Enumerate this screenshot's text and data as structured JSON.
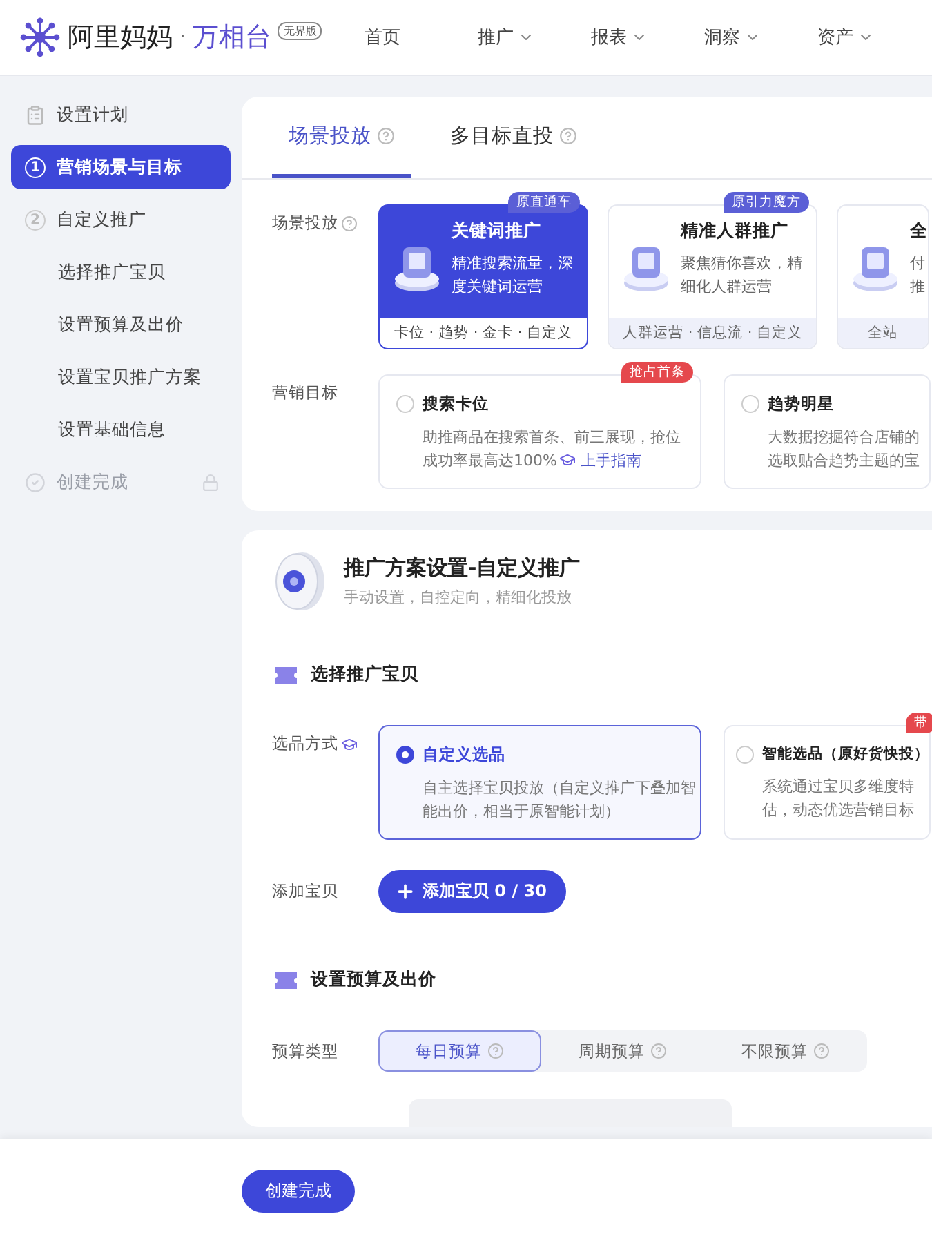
{
  "header": {
    "logo": {
      "brand": "阿里妈妈",
      "separator": "·",
      "product": "万相台",
      "edition": "无界版"
    },
    "nav": [
      {
        "label": "首页",
        "dropdown": false
      },
      {
        "label": "推广",
        "dropdown": true
      },
      {
        "label": "报表",
        "dropdown": true
      },
      {
        "label": "洞察",
        "dropdown": true
      },
      {
        "label": "资产",
        "dropdown": true
      }
    ]
  },
  "sidebar": {
    "items": [
      {
        "kind": "header",
        "label": "设置计划",
        "selected": false,
        "disabled": false
      },
      {
        "kind": "step",
        "number": "1",
        "label": "营销场景与目标",
        "selected": true,
        "disabled": false
      },
      {
        "kind": "step",
        "number": "2",
        "label": "自定义推广",
        "selected": false,
        "disabled": false
      },
      {
        "kind": "sub",
        "label": "选择推广宝贝",
        "selected": false,
        "disabled": false
      },
      {
        "kind": "sub",
        "label": "设置预算及出价",
        "selected": false,
        "disabled": false
      },
      {
        "kind": "sub",
        "label": "设置宝贝推广方案",
        "selected": false,
        "disabled": false
      },
      {
        "kind": "sub",
        "label": "设置基础信息",
        "selected": false,
        "disabled": false
      },
      {
        "kind": "final",
        "label": "创建完成",
        "selected": false,
        "disabled": true
      }
    ]
  },
  "scene_panel": {
    "tabs": [
      {
        "label": "场景投放",
        "selected": true
      },
      {
        "label": "多目标直投",
        "selected": false
      }
    ],
    "scene_label": "场景投放",
    "scenes": [
      {
        "badge": "原直通车",
        "title": "关键词推广",
        "desc": [
          "精准搜索流量，深",
          "度关键词运营"
        ],
        "footer": "卡位 · 趋势 · 金卡 · 自定义",
        "selected": true
      },
      {
        "badge": "原引力魔方",
        "title": "精准人群推广",
        "desc": [
          "聚焦猜你喜欢，精",
          "细化人群运营"
        ],
        "footer": "人群运营 · 信息流 · 自定义",
        "selected": false
      },
      {
        "title": "全",
        "desc": [
          "付",
          "推"
        ],
        "footer": "全站",
        "selected": false
      }
    ],
    "goal_label": "营销目标",
    "goals": [
      {
        "badge": "抢占首条",
        "title": "搜索卡位",
        "desc": "助推商品在搜索首条、前三展现，抢位成功率最高达100%",
        "link": "上手指南",
        "selected": false
      },
      {
        "title": "趋势明星",
        "desc_lines": [
          "大数据挖掘符合店铺的",
          "选取贴合趋势主题的宝"
        ],
        "selected": false
      }
    ]
  },
  "plan_panel": {
    "title": "推广方案设置-自定义推广",
    "subtitle": "手动设置，自控定向，精细化投放",
    "sections": [
      {
        "title": "选择推广宝贝",
        "method_label": "选品方式",
        "options": [
          {
            "title": "自定义选品",
            "desc": "自主选择宝贝投放（自定义推广下叠加智能出价，相当于原智能计划）",
            "selected": true
          },
          {
            "badge": "带",
            "title": "智能选品（原好货快投）",
            "desc_lines": [
              "系统通过宝贝多维度特",
              "估，动态优选营销目标"
            ],
            "selected": false
          }
        ],
        "add_label": "添加宝贝",
        "add_button": "添加宝贝 0 / 30"
      },
      {
        "title": "设置预算及出价",
        "budget_label": "预算类型",
        "budget_types": [
          {
            "label": "每日预算",
            "selected": true
          },
          {
            "label": "周期预算",
            "selected": false
          },
          {
            "label": "不限预算",
            "selected": false
          }
        ]
      }
    ]
  },
  "footer": {
    "submit": "创建完成"
  }
}
